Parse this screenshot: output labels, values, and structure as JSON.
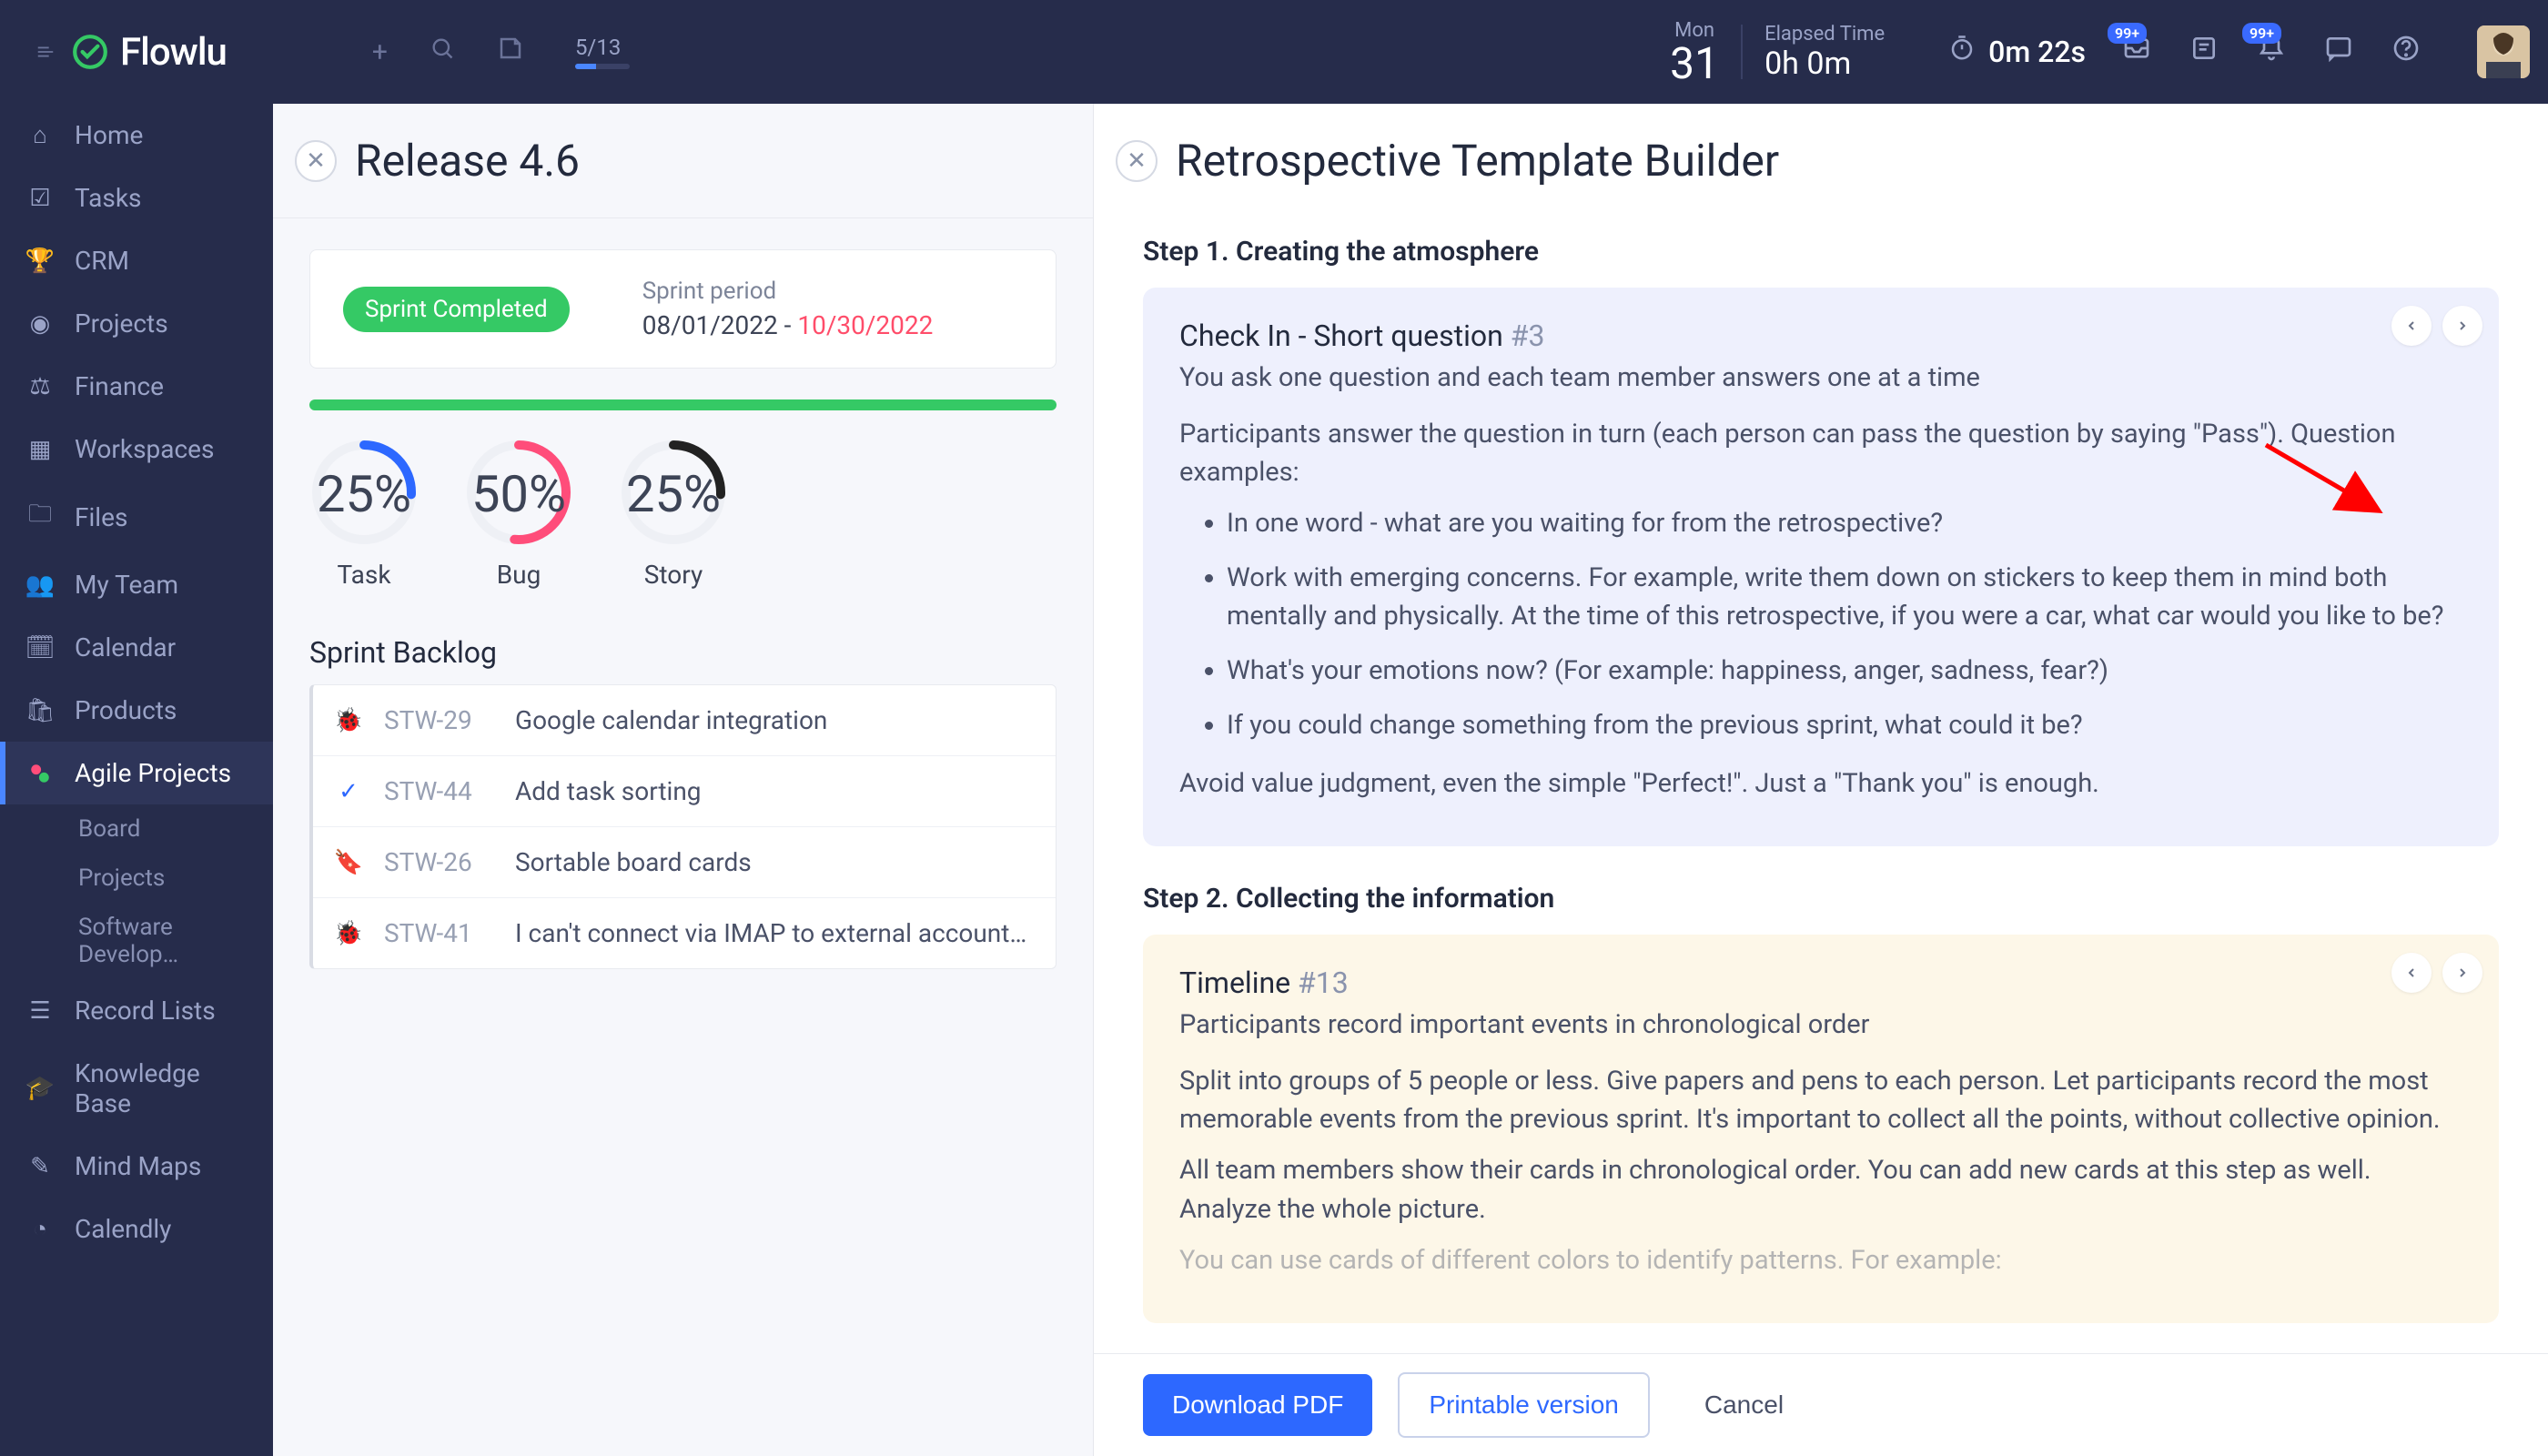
{
  "header": {
    "brand": "Flowlu",
    "progress": "5/13",
    "date_dow": "Mon",
    "date_num": "31",
    "elapsed_lbl": "Elapsed Time",
    "elapsed_val": "0h 0m",
    "timer": "0m 22s",
    "badge1": "99+",
    "badge2": "99+"
  },
  "sidebar": {
    "items": [
      {
        "label": "Home"
      },
      {
        "label": "Tasks"
      },
      {
        "label": "CRM"
      },
      {
        "label": "Projects"
      },
      {
        "label": "Finance"
      },
      {
        "label": "Workspaces"
      },
      {
        "label": "Files"
      },
      {
        "label": "My Team"
      },
      {
        "label": "Calendar"
      },
      {
        "label": "Products"
      },
      {
        "label": "Agile Projects"
      },
      {
        "label": "Record Lists"
      },
      {
        "label": "Knowledge Base"
      },
      {
        "label": "Mind Maps"
      },
      {
        "label": "Calendly"
      }
    ],
    "subs": [
      "Board",
      "Projects",
      "Software Develop…"
    ]
  },
  "mid": {
    "title": "Release 4.6",
    "pill": "Sprint Completed",
    "sprint_lbl": "Sprint period",
    "sprint_start": "08/01/2022",
    "sprint_sep": "  -  ",
    "sprint_end": "10/30/2022",
    "gauges": [
      {
        "pct": "25%",
        "label": "Task",
        "color": "#2d68ff",
        "dash": "42 126"
      },
      {
        "pct": "50%",
        "label": "Bug",
        "color": "#ff4d7a",
        "dash": "84 84"
      },
      {
        "pct": "25%",
        "label": "Story",
        "color": "#222",
        "dash": "42 126"
      }
    ],
    "backlog_h": "Sprint Backlog",
    "backlog": [
      {
        "icon": "bug",
        "color": "#ff4d4d",
        "key": "STW-29",
        "title": "Google calendar integration"
      },
      {
        "icon": "check",
        "color": "#2d68ff",
        "key": "STW-44",
        "title": "Add task sorting"
      },
      {
        "icon": "bookmark",
        "color": "#222",
        "key": "STW-26",
        "title": "Sortable board cards"
      },
      {
        "icon": "bug",
        "color": "#ff4d4d",
        "key": "STW-41",
        "title": "I can't connect via IMAP to external accounts us…"
      }
    ]
  },
  "right": {
    "title": "Retrospective Template Builder",
    "step1_h": "Step 1. Creating the atmosphere",
    "step1": {
      "title": "Check In - Short question ",
      "tag": "#3",
      "sub": "You ask one question and each team member answers one at a time",
      "intro": "Participants answer the question in turn (each person can pass the question by saying \"Pass\"). Question examples:",
      "bullets": [
        "In one word - what are you waiting for from the retrospective?",
        "Work with emerging concerns. For example, write them down on stickers to keep them in mind both mentally and physically. At the time of this retrospective, if you were a car, what car would you like to be?",
        "What's your emotions now? (For example: happiness, anger, sadness, fear?)",
        "If you could change something from the previous sprint, what could it be?"
      ],
      "outro": "Avoid value judgment, even the simple \"Perfect!\". Just a \"Thank you\" is enough."
    },
    "step2_h": "Step 2. Collecting the information",
    "step2": {
      "title": "Timeline ",
      "tag": "#13",
      "sub": "Participants record important events in chronological order",
      "p1": "Split into groups of 5 people or less. Give papers and pens to each person. Let participants record the most memorable events from the previous sprint. It's important to collect all the points, without collective opinion.",
      "p2": "All team members show their cards in chronological order. You can add new cards at this step as well. Analyze the whole picture.",
      "p3": "You can use cards of different colors to identify patterns. For example:"
    }
  },
  "footer": {
    "download": "Download PDF",
    "print": "Printable version",
    "cancel": "Cancel"
  }
}
